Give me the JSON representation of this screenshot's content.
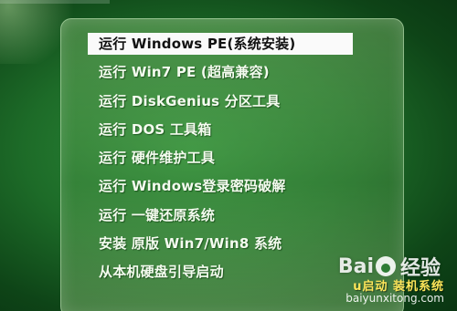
{
  "menu": {
    "items": [
      {
        "label": "运行 Windows PE(系统安装)",
        "selected": true
      },
      {
        "label": "运行 Win7 PE (超高兼容)",
        "selected": false
      },
      {
        "label": "运行 DiskGenius 分区工具",
        "selected": false
      },
      {
        "label": "运行 DOS 工具箱",
        "selected": false
      },
      {
        "label": "运行 硬件维护工具",
        "selected": false
      },
      {
        "label": "运行 Windows登录密码破解",
        "selected": false
      },
      {
        "label": "运行 一键还原系统",
        "selected": false
      },
      {
        "label": "安装 原版 Win7/Win8 系统",
        "selected": false
      },
      {
        "label": "从本机硬盘引导启动",
        "selected": false
      }
    ]
  },
  "watermark": {
    "logo_prefix": "Bai",
    "logo_suffix": "经验",
    "tagline": "u启动 装机系统",
    "url": "baiyunxitong.com",
    "brand_color": "#ffe75a"
  },
  "colors": {
    "background": "#1d6b28",
    "selected_background": "#fafafa",
    "menu_text": "#f4fbef"
  }
}
